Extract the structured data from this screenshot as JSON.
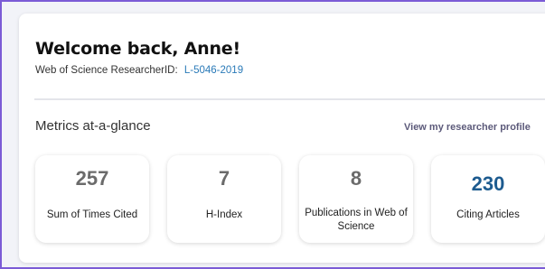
{
  "welcome": {
    "title": "Welcome back, Anne!",
    "researcher_id_label": "Web of Science ResearcherID:",
    "researcher_id_value": "L-5046-2019"
  },
  "metrics": {
    "section_title": "Metrics at-a-glance",
    "profile_link": "View my researcher profile",
    "tiles": [
      {
        "value": "257",
        "label": "Sum of Times Cited"
      },
      {
        "value": "7",
        "label": "H-Index"
      },
      {
        "value": "8",
        "label": "Publications in Web of Science"
      },
      {
        "value": "230",
        "label": "Citing Articles"
      }
    ]
  },
  "colors": {
    "accent_value": "#1d5b8f",
    "link": "#2a7ab8",
    "frame_border": "#7b5bd6"
  }
}
